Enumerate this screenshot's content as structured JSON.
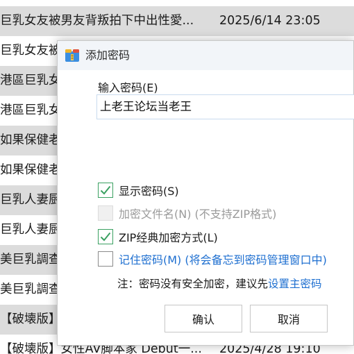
{
  "file_list": {
    "rows": [
      {
        "name": "巨乳女友被男友背叛拍下中出性愛...",
        "date": "2025/6/14 23:05"
      },
      {
        "name": "巨乳女友被",
        "date": ""
      },
      {
        "name": "港區巨乳女",
        "date": ""
      },
      {
        "name": "港區巨乳女",
        "date": ""
      },
      {
        "name": "如果保健老",
        "date": ""
      },
      {
        "name": "如果保健老",
        "date": ""
      },
      {
        "name": "巨乳人妻厨",
        "date": ""
      },
      {
        "name": "巨乳人妻厨",
        "date": ""
      },
      {
        "name": "美巨乳調查",
        "date": ""
      },
      {
        "name": "美巨乳調查",
        "date": ""
      },
      {
        "name": "【破壊版】",
        "date": ""
      },
      {
        "name": "【破壊版】女性AV脚本家 Debut一...",
        "date": "2025/4/28 19:10"
      }
    ]
  },
  "dialog": {
    "title": "添加密码",
    "password_label": "输入密码(E)",
    "password_value": "上老王论坛当老王",
    "options": {
      "show_password": {
        "label": "显示密码(S)",
        "checked": true
      },
      "encrypt_filenames": {
        "label": "加密文件名(N) (不支持ZIP格式)",
        "checked": false,
        "disabled": true
      },
      "zip_classic": {
        "label": "ZIP经典加密方式(L)",
        "checked": true
      },
      "remember_password": {
        "label": "记住密码(M) (将会备忘到密码管理窗口中)",
        "checked": false
      }
    },
    "note_prefix": "注：密码没有安全加密，建议先",
    "note_link": "设置主密码",
    "ok_label": "确认",
    "cancel_label": "取消"
  },
  "colors": {
    "accent_link": "#1e6fd0",
    "check_green": "#3aa061",
    "row_alt": "#dcdcdc"
  },
  "icons": {
    "title_icon": "archive-icon",
    "check": "checkmark-icon"
  }
}
